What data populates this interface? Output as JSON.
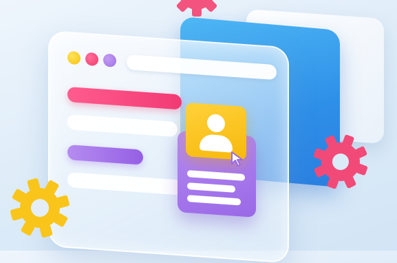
{
  "scene": {
    "colors": {
      "background": "#dcebf8",
      "blue_panel": "#2e8fe8",
      "pink_accent": "#f23a74",
      "purple_accent": "#9c6fe6",
      "yellow_accent": "#f7b80c"
    },
    "window_controls": [
      "yellow-dot",
      "red-dot",
      "purple-dot"
    ],
    "icons": [
      "gear-icon",
      "user-avatar-icon",
      "mouse-pointer-icon"
    ]
  }
}
